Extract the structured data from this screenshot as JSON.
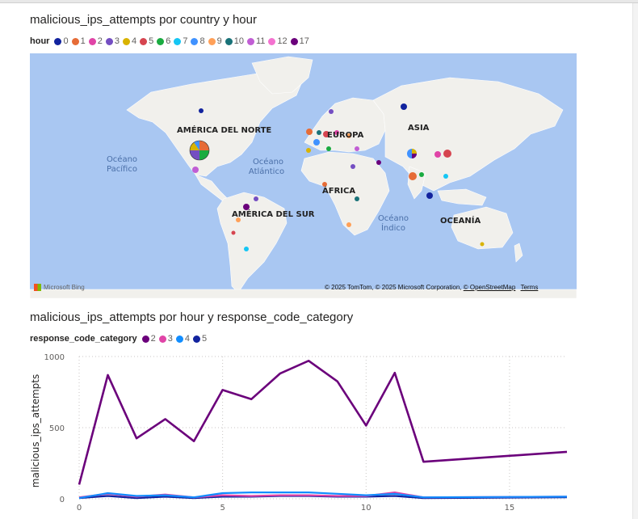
{
  "map_visual": {
    "title": "malicious_ips_attempts por country y hour",
    "legend_title": "hour",
    "legend_items": [
      {
        "label": "0",
        "color": "#12239e"
      },
      {
        "label": "1",
        "color": "#e66c37"
      },
      {
        "label": "2",
        "color": "#e044a7"
      },
      {
        "label": "3",
        "color": "#744ec2"
      },
      {
        "label": "4",
        "color": "#d9b300"
      },
      {
        "label": "5",
        "color": "#d64550"
      },
      {
        "label": "6",
        "color": "#1aab40"
      },
      {
        "label": "7",
        "color": "#15c6f4"
      },
      {
        "label": "8",
        "color": "#4092ff"
      },
      {
        "label": "9",
        "color": "#ffa058"
      },
      {
        "label": "10",
        "color": "#197278"
      },
      {
        "label": "11",
        "color": "#c15ed4"
      },
      {
        "label": "12",
        "color": "#f472d0"
      },
      {
        "label": "17",
        "color": "#6b007b"
      }
    ],
    "continent_labels": [
      "AMÉRICA DEL NORTE",
      "EUROPA",
      "ASIA",
      "ÁFRICA",
      "AMÉRICA DEL SUR",
      "OCEANÍA"
    ],
    "ocean_labels": {
      "pacific": [
        "Océano",
        "Pacífico"
      ],
      "atlantic": [
        "Océano",
        "Atlántico"
      ],
      "indian": [
        "Océano",
        "Índico"
      ]
    },
    "credit_text": "© 2025 TomTom, © 2025 Microsoft Corporation,",
    "credit_link": "© OpenStreetMap",
    "terms_link": "Terms",
    "bing_text": "Microsoft Bing"
  },
  "line_visual": {
    "title": "malicious_ips_attempts por hour y response_code_category",
    "legend_title": "response_code_category",
    "legend_items": [
      {
        "label": "2",
        "color": "#6b007b"
      },
      {
        "label": "3",
        "color": "#e044a7"
      },
      {
        "label": "4",
        "color": "#118dff"
      },
      {
        "label": "5",
        "color": "#12239e"
      }
    ]
  },
  "chart_data": {
    "type": "line",
    "title": "malicious_ips_attempts por hour y response_code_category",
    "xlabel": "",
    "ylabel": "malicious_ips_attempts",
    "xlim": [
      0,
      17
    ],
    "ylim": [
      0,
      1000
    ],
    "x_ticks": [
      0,
      5,
      10,
      15
    ],
    "y_ticks": [
      0,
      500,
      1000
    ],
    "grid": true,
    "legend_position": "top-left",
    "x": [
      0,
      1,
      2,
      3,
      4,
      5,
      6,
      7,
      8,
      9,
      10,
      11,
      12,
      17
    ],
    "series": [
      {
        "name": "2",
        "color": "#6b007b",
        "values": [
          100,
          870,
          425,
          560,
          405,
          765,
          700,
          880,
          970,
          825,
          515,
          885,
          260,
          330
        ]
      },
      {
        "name": "3",
        "color": "#e044a7",
        "values": [
          10,
          35,
          15,
          30,
          10,
          25,
          20,
          25,
          25,
          20,
          20,
          45,
          10,
          15
        ]
      },
      {
        "name": "4",
        "color": "#118dff",
        "values": [
          5,
          40,
          20,
          25,
          10,
          40,
          45,
          45,
          45,
          35,
          25,
          35,
          10,
          15
        ]
      },
      {
        "name": "5",
        "color": "#12239e",
        "values": [
          5,
          20,
          5,
          15,
          5,
          15,
          15,
          20,
          20,
          15,
          15,
          20,
          5,
          10
        ]
      }
    ]
  }
}
